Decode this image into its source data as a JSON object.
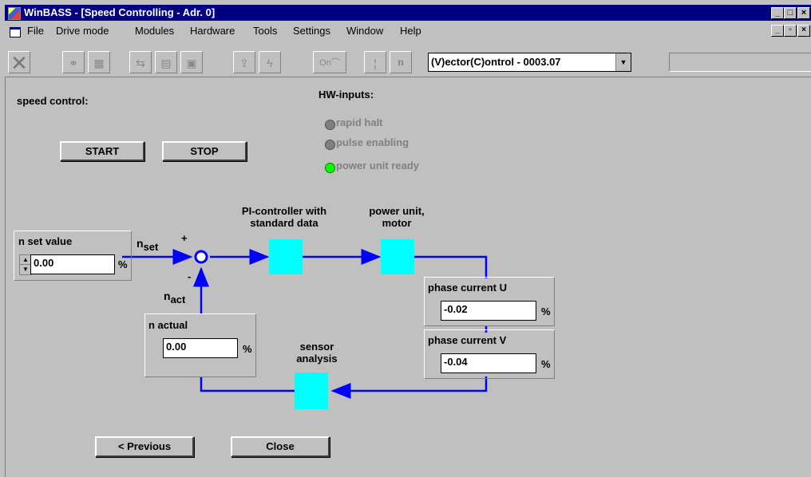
{
  "window": {
    "title": "WinBASS - [Speed Controlling - Adr. 0]"
  },
  "menu": [
    "File",
    "Drive mode",
    "Modules",
    "Hardware",
    "Tools",
    "Settings",
    "Window",
    "Help"
  ],
  "toolbar": {
    "drive_select": "(V)ector(C)ontrol - 0003.07",
    "on_label": "On",
    "n_label": "n"
  },
  "speed_control": {
    "heading": "speed control:",
    "start_label": "START",
    "stop_label": "STOP"
  },
  "hw_inputs": {
    "heading": "HW-inputs:",
    "items": [
      {
        "label": "rapid halt",
        "color": "#808080"
      },
      {
        "label": "pulse enabling",
        "color": "#808080"
      },
      {
        "label": "power unit ready",
        "color": "#00ff00"
      }
    ]
  },
  "diagram": {
    "n_set_value": {
      "label": "n set value",
      "value": "0.00",
      "unit": "%"
    },
    "n_set_signal": {
      "main": "n",
      "sub": "set"
    },
    "n_act_signal": {
      "main": "n",
      "sub": "act"
    },
    "plus": "+",
    "minus": "-",
    "pi_controller": {
      "line1": "PI-controller with",
      "line2": "standard data"
    },
    "power_unit": {
      "line1": "power unit,",
      "line2": "motor"
    },
    "phase_current_u": {
      "label": "phase current U",
      "value": "-0.02",
      "unit": "%"
    },
    "phase_current_v": {
      "label": "phase current V",
      "value": "-0.04",
      "unit": "%"
    },
    "n_actual": {
      "label": "n actual",
      "value": "0.00",
      "unit": "%"
    },
    "sensor": {
      "line1": "sensor",
      "line2": "analysis"
    },
    "block_color": "#00ffff",
    "line_color": "#0000ff"
  },
  "footer": {
    "previous_label": "< Previous",
    "close_label": "Close"
  }
}
